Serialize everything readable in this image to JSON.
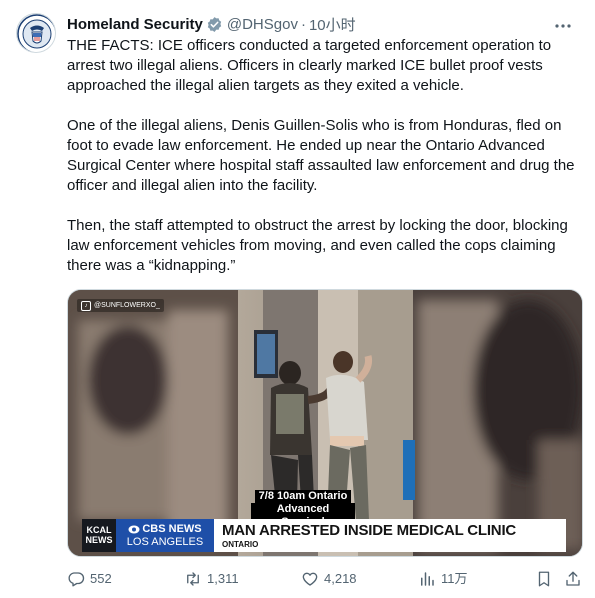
{
  "author": {
    "name": "Homeland Security",
    "handle": "@DHSgov",
    "separator": "·",
    "time": "10小时"
  },
  "tweet": {
    "paragraphs": [
      "THE FACTS: ICE officers conducted a targeted enforcement operation to arrest two illegal aliens. Officers in clearly marked ICE bullet proof vests approached the illegal alien targets as they exited a vehicle.",
      "One of the illegal aliens, Denis Guillen-Solis who is from Honduras, fled on foot to evade law enforcement. He ended up near the Ontario Advanced Surgical Center where hospital staff assaulted law enforcement and drug the officer and illegal alien into the facility.",
      "Then, the staff attempted to obstruct the arrest by locking the door, blocking law enforcement vehicles from moving, and even called the cops claiming there was a “kidnapping.”"
    ]
  },
  "video": {
    "watermark": "@SUNFLOWERXO_",
    "caption_line1": "7/8 10am Ontario",
    "caption_line2": "Advanced Surgical",
    "kcal_line1": "KCAL",
    "kcal_line2": "NEWS",
    "cbs_line1": "CBS NEWS",
    "cbs_line2": "LOS ANGELES",
    "headline": "MAN ARRESTED INSIDE MEDICAL CLINIC",
    "subhead": "ONTARIO"
  },
  "actions": {
    "replies": "552",
    "retweets": "1,311",
    "likes": "4,218",
    "views": "11万"
  },
  "colors": {
    "accent": "#1d9bf0",
    "muted": "#536471",
    "text": "#0f1419"
  }
}
